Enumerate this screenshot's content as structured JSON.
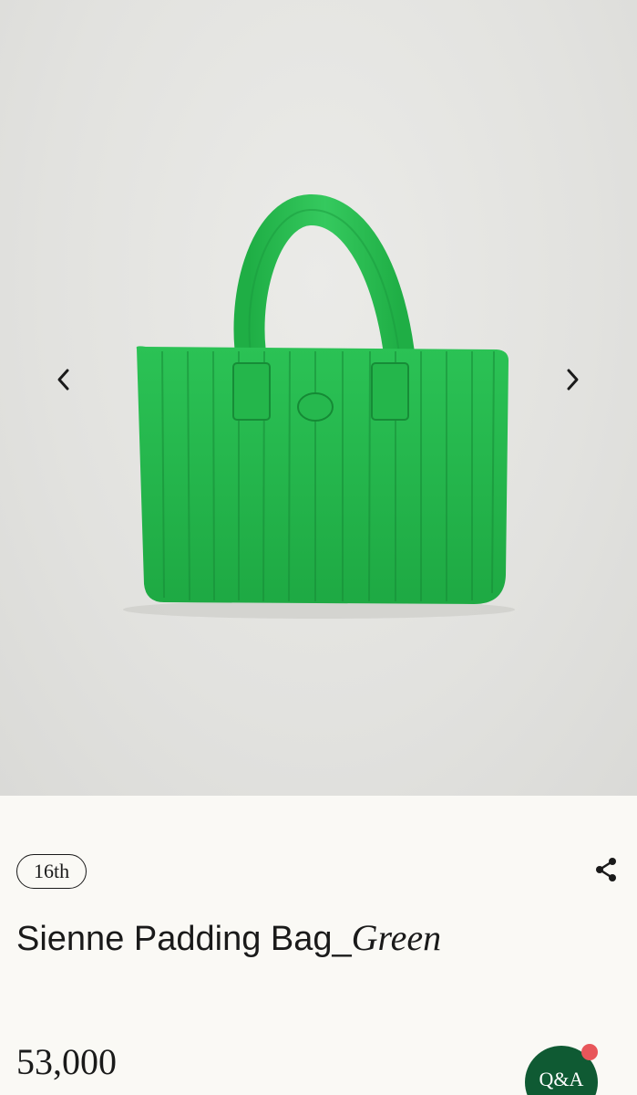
{
  "product": {
    "edition": "16th",
    "title_plain": "Sienne Padding Bag_",
    "title_italic": "Green",
    "price": "53,000",
    "color": "#22b84a"
  },
  "gallery": {
    "prev_icon": "chevron-left-icon",
    "next_icon": "chevron-right-icon"
  },
  "actions": {
    "share_icon": "share-icon",
    "qa_label": "Q&A",
    "qa_color": "#0f5a33",
    "qa_badge_color": "#e8565a"
  }
}
